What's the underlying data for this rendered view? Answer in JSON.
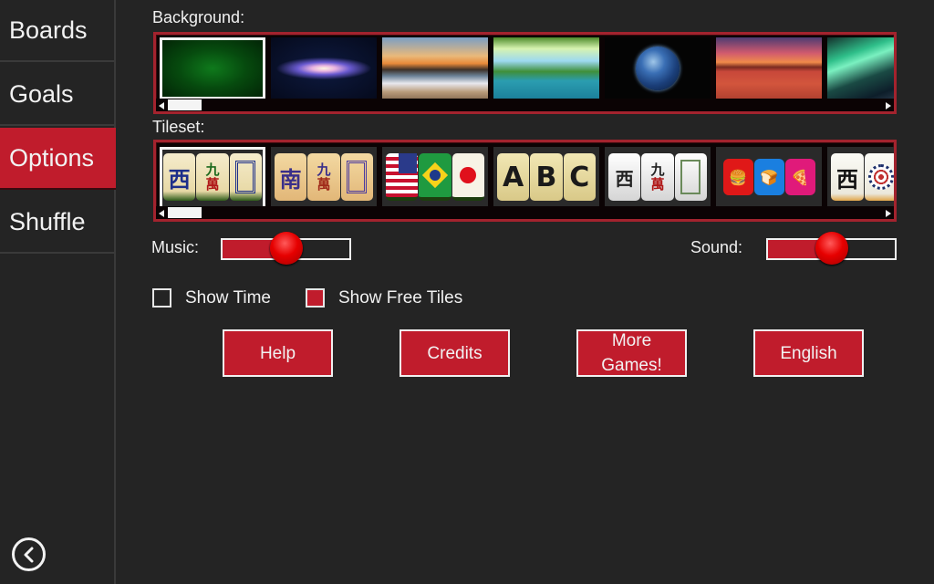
{
  "sidebar": {
    "items": [
      {
        "label": "Boards",
        "active": false
      },
      {
        "label": "Goals",
        "active": false
      },
      {
        "label": "Options",
        "active": true
      },
      {
        "label": "Shuffle",
        "active": false
      }
    ],
    "back_icon": "circle-chevron-left-icon"
  },
  "background": {
    "label": "Background:",
    "selected_index": 0,
    "options": [
      "Green Felt",
      "Galaxy",
      "Beach Sunset",
      "Forest Lake",
      "Earth",
      "Red Desert",
      "Aurora"
    ]
  },
  "tileset": {
    "label": "Tileset:",
    "selected_index": 0,
    "options": [
      {
        "name": "Classic Ivory",
        "tiles": [
          "西",
          "九萬",
          "▯"
        ]
      },
      {
        "name": "Wood",
        "tiles": [
          "南",
          "九萬",
          "▯"
        ]
      },
      {
        "name": "Flags",
        "tiles": [
          "USA",
          "Brazil",
          "Japan"
        ]
      },
      {
        "name": "ABC",
        "tiles": [
          "A",
          "B",
          "C"
        ]
      },
      {
        "name": "White",
        "tiles": [
          "西",
          "九萬",
          "▯"
        ]
      },
      {
        "name": "Food",
        "tiles": [
          "burger",
          "bread",
          "pizza"
        ]
      },
      {
        "name": "Traditional",
        "tiles": [
          "西",
          "◎"
        ]
      }
    ]
  },
  "music": {
    "label": "Music:",
    "value_percent": 50
  },
  "sound": {
    "label": "Sound:",
    "value_percent": 50
  },
  "checkboxes": [
    {
      "label": "Show Time",
      "checked": false
    },
    {
      "label": "Show Free Tiles",
      "checked": true
    }
  ],
  "buttons": {
    "help": "Help",
    "credits": "Credits",
    "more_games": "More Games!",
    "language": "English"
  },
  "colors": {
    "accent": "#c01c2c",
    "background": "#242424",
    "carousel_border": "#a3232e"
  }
}
